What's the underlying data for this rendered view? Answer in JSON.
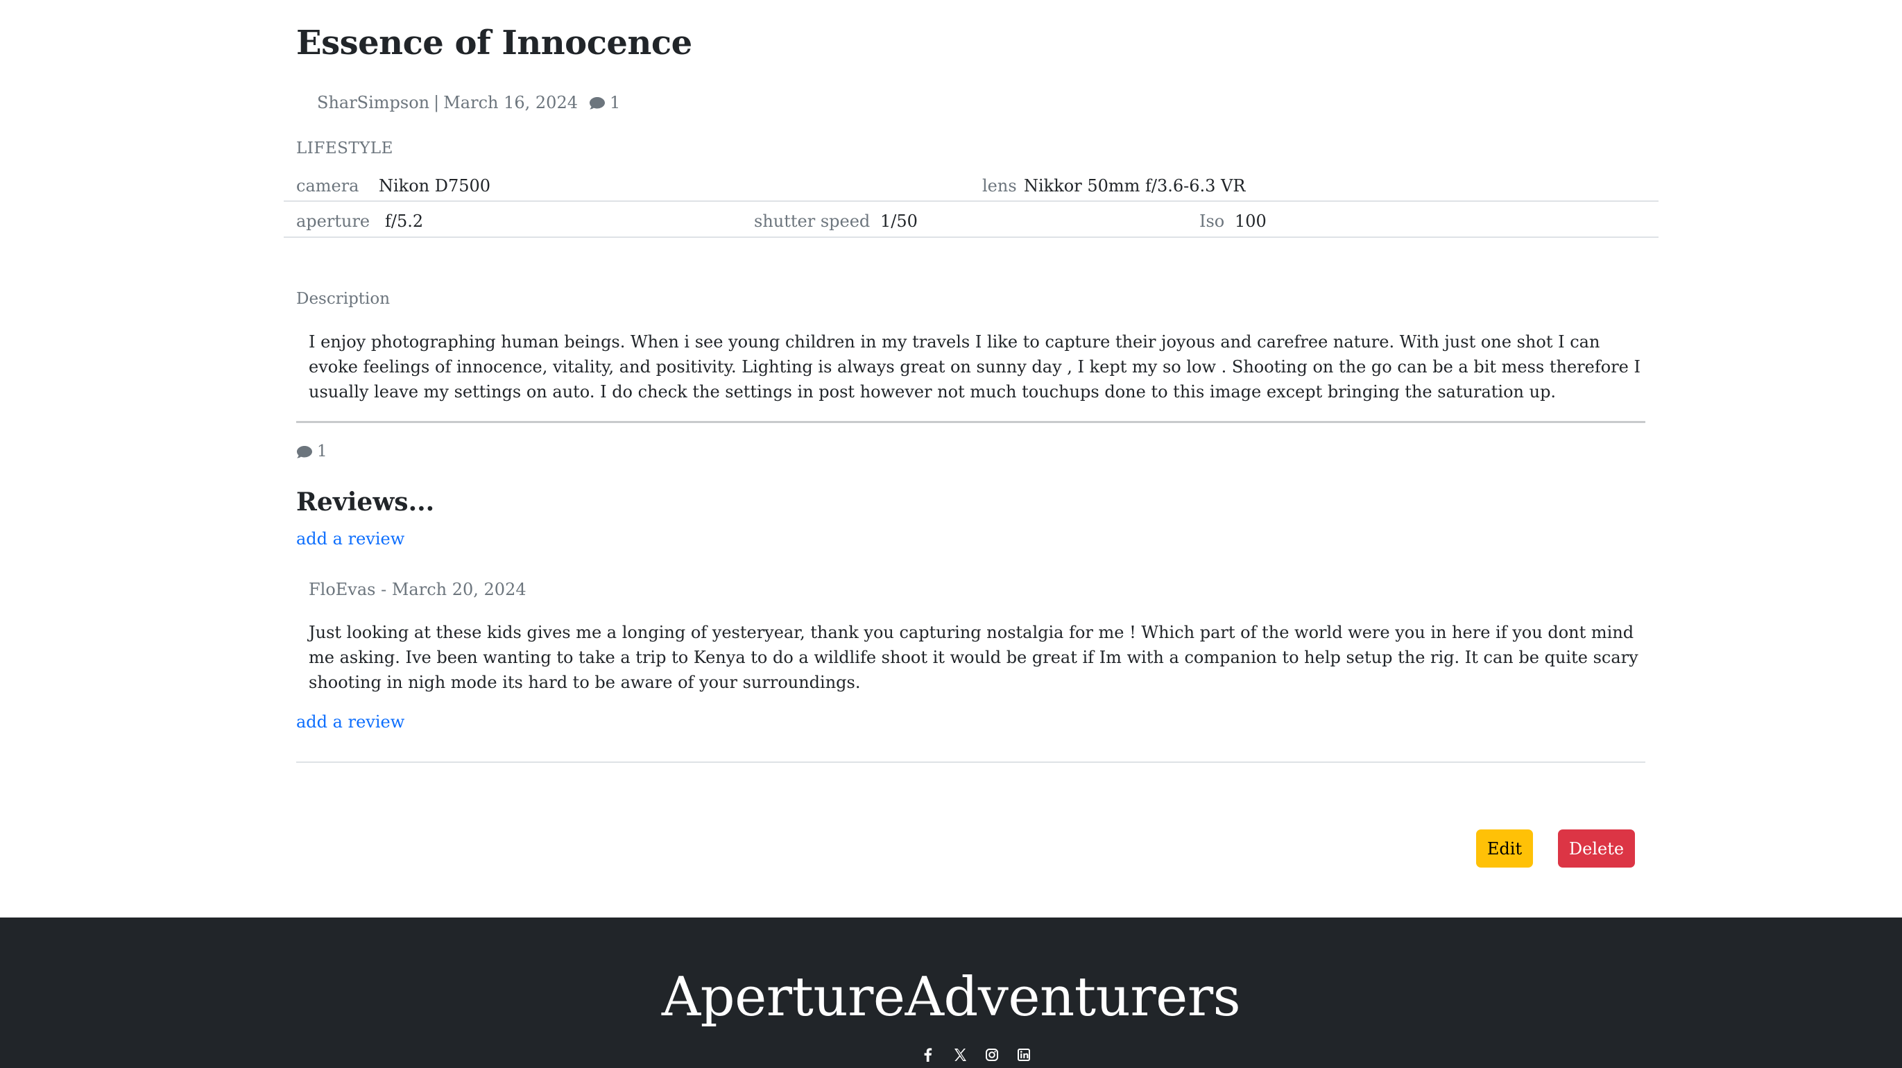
{
  "post": {
    "title": "Essence of Innocence",
    "author": "SharSimpson",
    "separator": "|",
    "date": "March 16, 2024",
    "comment_count": "1",
    "category": "LIFESTYLE"
  },
  "specs": {
    "camera_label": "camera",
    "camera_value": "Nikon D7500",
    "lens_label": "lens",
    "lens_value": "Nikkor 50mm f/3.6-6.3 VR",
    "aperture_label": "aperture",
    "aperture_value": "f/5.2",
    "shutter_label": "shutter speed",
    "shutter_value": "1/50",
    "iso_label": "Iso",
    "iso_value": "100"
  },
  "description": {
    "label": "Description",
    "text": "I enjoy photographing human beings. When i see young children in my travels I like to capture their joyous and carefree nature. With just one shot I can evoke feelings of innocence, vitality, and positivity. Lighting is always great on sunny day , I kept my so low . Shooting on the go can be a bit mess therefore I usually leave my settings on auto. I do check the settings in post however not much touchups done to this image except bringing the saturation up."
  },
  "reviews": {
    "comment_count": "1",
    "title": "Reviews...",
    "add_link": "add a review",
    "items": [
      {
        "meta": "FloEvas - March 20, 2024",
        "text": "Just looking at these kids gives me a longing of yesteryear, thank you capturing nostalgia for me ! Which part of the world were you in here if you dont mind me asking. Ive been wanting to take a trip to Kenya to do a wildlife shoot it would be great if Im with a companion to help setup the rig. It can be quite scary shooting in nigh mode its hard to be aware of your surroundings."
      }
    ],
    "add_link_2": "add a review"
  },
  "actions": {
    "edit": "Edit",
    "delete": "Delete"
  },
  "footer": {
    "brand": "ApertureAdventurers",
    "social_icons": [
      "facebook-icon",
      "x-icon",
      "instagram-icon",
      "linkedin-icon"
    ]
  },
  "colors": {
    "link": "#0d6efd",
    "edit": "#ffc107",
    "delete": "#dc3545",
    "footer": "#212529",
    "muted": "#6c757d"
  }
}
